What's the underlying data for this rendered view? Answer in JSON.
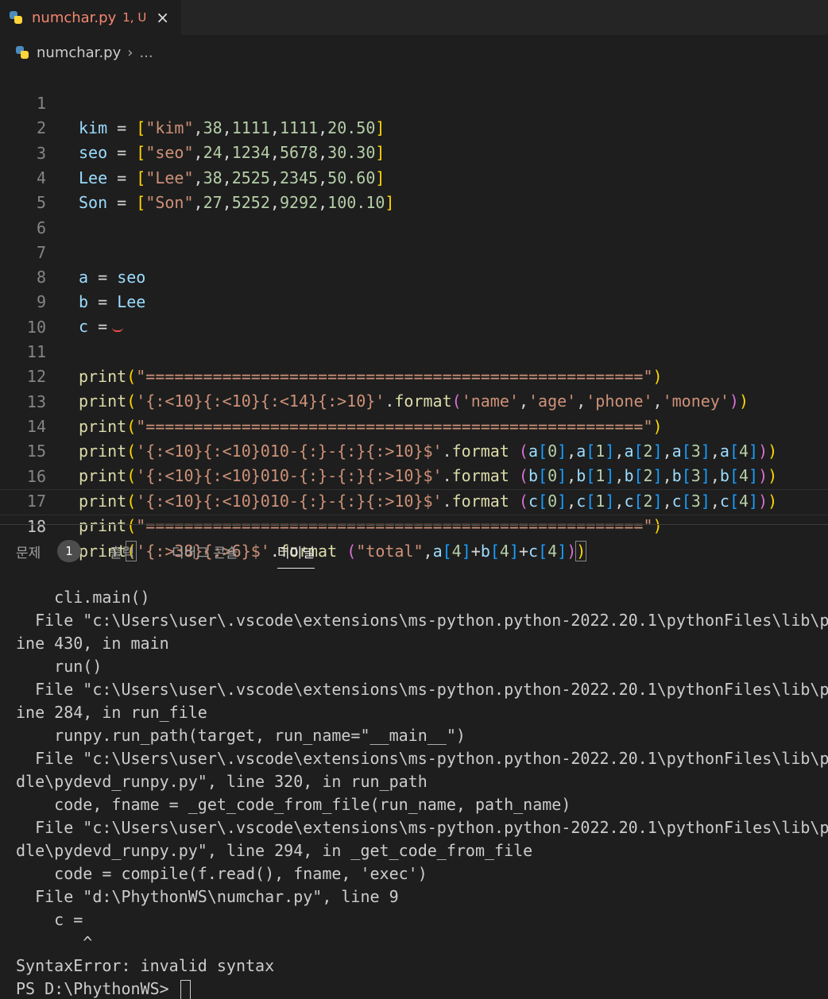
{
  "tab": {
    "filename": "numchar.py",
    "status": "1, U",
    "close_icon": "×"
  },
  "breadcrumb": {
    "file": "numchar.py",
    "separator": "›",
    "more": "..."
  },
  "editor": {
    "line_numbers": [
      "1",
      "2",
      "3",
      "4",
      "5",
      "6",
      "7",
      "8",
      "9",
      "10",
      "11",
      "12",
      "13",
      "14",
      "15",
      "16",
      "17",
      "18"
    ],
    "active_line": "18",
    "tokens": {
      "kim": "kim",
      "seo": "seo",
      "Lee": "Lee",
      "Son": "Son",
      "eq": "=",
      "comma": ",",
      "lbr": "[",
      "rbr": "]",
      "lp": "(",
      "rp": ")",
      "dot": ".",
      "plus": "+",
      "s_kim": "\"kim\"",
      "s_seo": "\"seo\"",
      "s_Lee": "\"Lee\"",
      "s_Son": "\"Son\"",
      "n_38": "38",
      "n_24": "24",
      "n_27": "27",
      "n_1111": "1111",
      "n_1234": "1234",
      "n_5678": "5678",
      "n_2525": "2525",
      "n_2345": "2345",
      "n_5252": "5252",
      "n_9292": "9292",
      "n_2050": "20.50",
      "n_3030": "30.30",
      "n_5060": "50.60",
      "n_10010": "100.10",
      "a": "a",
      "b": "b",
      "c": "c",
      "n0": "0",
      "n1": "1",
      "n2": "2",
      "n3": "3",
      "n4": "4",
      "print": "print",
      "format": "format",
      "s_eqs": "\"====================================================\"",
      "s_hdr": "'{:<10}{:<10}{:<14}{:>10}'",
      "s_name": "'name'",
      "s_age": "'age'",
      "s_phone": "'phone'",
      "s_money": "'money'",
      "s_row": "'{:<10}{:<10}010-{:}-{:}{:>10}$'",
      "s_tot": "'{:>38}{:>6}$'",
      "s_total": "\"total\""
    }
  },
  "panel": {
    "tabs": [
      "문제",
      "출력",
      "디버그 콘솔",
      "터미널"
    ],
    "problem_count": "1",
    "active_tab": "터미널"
  },
  "terminal": {
    "lines": [
      "    cli.main()",
      "  File \"c:\\Users\\user\\.vscode\\extensions\\ms-python.python-2022.20.1\\pythonFiles\\lib\\py",
      "ine 430, in main",
      "    run()",
      "  File \"c:\\Users\\user\\.vscode\\extensions\\ms-python.python-2022.20.1\\pythonFiles\\lib\\py",
      "ine 284, in run_file",
      "    runpy.run_path(target, run_name=\"__main__\")",
      "  File \"c:\\Users\\user\\.vscode\\extensions\\ms-python.python-2022.20.1\\pythonFiles\\lib\\py",
      "dle\\pydevd_runpy.py\", line 320, in run_path",
      "    code, fname = _get_code_from_file(run_name, path_name)",
      "  File \"c:\\Users\\user\\.vscode\\extensions\\ms-python.python-2022.20.1\\pythonFiles\\lib\\py",
      "dle\\pydevd_runpy.py\", line 294, in _get_code_from_file",
      "    code = compile(f.read(), fname, 'exec')",
      "  File \"d:\\PhythonWS\\numchar.py\", line 9",
      "    c =",
      "       ^",
      "SyntaxError: invalid syntax"
    ],
    "prompt": "PS D:\\PhythonWS> "
  }
}
